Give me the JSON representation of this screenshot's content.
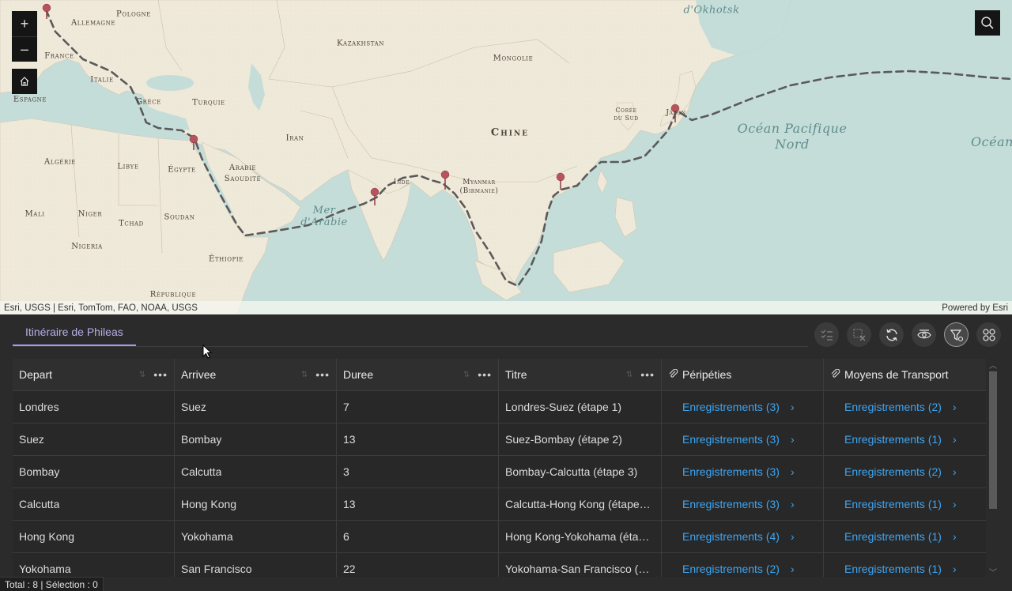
{
  "map": {
    "zoom_in": "+",
    "zoom_out": "–",
    "attribution_left": "Esri, USGS | Esri, TomTom, FAO, NOAA, USGS",
    "attribution_right": "Powered by Esri",
    "labels": {
      "allemagne": "Allemagne",
      "pologne": "Pologne",
      "france": "France",
      "italie": "Italie",
      "espagne": "Espagne",
      "grece": "Grèce",
      "turquie": "Turquie",
      "kazakhstan": "Kazakhstan",
      "mongolie": "Mongolie",
      "chine": "Chine",
      "coree": "Corée\ndu Sud",
      "japon": "Japon",
      "iran": "Iran",
      "algerie": "Algérie",
      "libye": "Libye",
      "egypte": "Égypte",
      "arabie": "Arabie\nSaoudite",
      "inde": "Inde",
      "myanmar": "Myanmar\n(Birmanie)",
      "mali": "Mali",
      "niger": "Niger",
      "tchad": "Tchad",
      "soudan": "Soudan",
      "nigeria": "Nigeria",
      "ethiopie": "Éthiopie",
      "republique": "République",
      "okhotsk": "d'Okhotsk",
      "mer_arabie": "Mer\nd'Arabie",
      "pacifique": "Océan Pacifique\nNord",
      "ocean_right": "Océan"
    }
  },
  "table": {
    "tab_label": "Itinéraire de Phileas",
    "columns": [
      "Depart",
      "Arrivee",
      "Duree",
      "Titre",
      "Péripéties",
      "Moyens de Transport"
    ],
    "rows": [
      {
        "depart": "Londres",
        "arrivee": "Suez",
        "duree": "7",
        "titre": "Londres-Suez (étape 1)",
        "peripeties": "Enregistrements (3)",
        "transport": "Enregistrements (2)"
      },
      {
        "depart": "Suez",
        "arrivee": "Bombay",
        "duree": "13",
        "titre": "Suez-Bombay (étape 2)",
        "peripeties": "Enregistrements (3)",
        "transport": "Enregistrements (1)"
      },
      {
        "depart": "Bombay",
        "arrivee": "Calcutta",
        "duree": "3",
        "titre": "Bombay-Calcutta (étape 3)",
        "peripeties": "Enregistrements (3)",
        "transport": "Enregistrements (2)"
      },
      {
        "depart": "Calcutta",
        "arrivee": "Hong Kong",
        "duree": "13",
        "titre": "Calcutta-Hong Kong (étape…",
        "peripeties": "Enregistrements (3)",
        "transport": "Enregistrements (1)"
      },
      {
        "depart": "Hong Kong",
        "arrivee": "Yokohama",
        "duree": "6",
        "titre": "Hong Kong-Yokohama (éta…",
        "peripeties": "Enregistrements (4)",
        "transport": "Enregistrements (1)"
      },
      {
        "depart": "Yokohama",
        "arrivee": "San Francisco",
        "duree": "22",
        "titre": "Yokohama-San Francisco (é…",
        "peripeties": "Enregistrements (2)",
        "transport": "Enregistrements (1)"
      }
    ],
    "status": "Total : 8 | Sélection : 0"
  },
  "colors": {
    "accent": "#a59af0",
    "link": "#3da5f4",
    "route": "#5a5a5a",
    "pin": "#b5545c"
  },
  "icons": [
    "search-icon",
    "home-icon",
    "select-all-icon",
    "clear-selection-icon",
    "refresh-icon",
    "show-selected-icon",
    "filter-by-extent-icon",
    "layout-icon",
    "attachment-icon",
    "chevron-right-icon",
    "map-pin-icon"
  ]
}
